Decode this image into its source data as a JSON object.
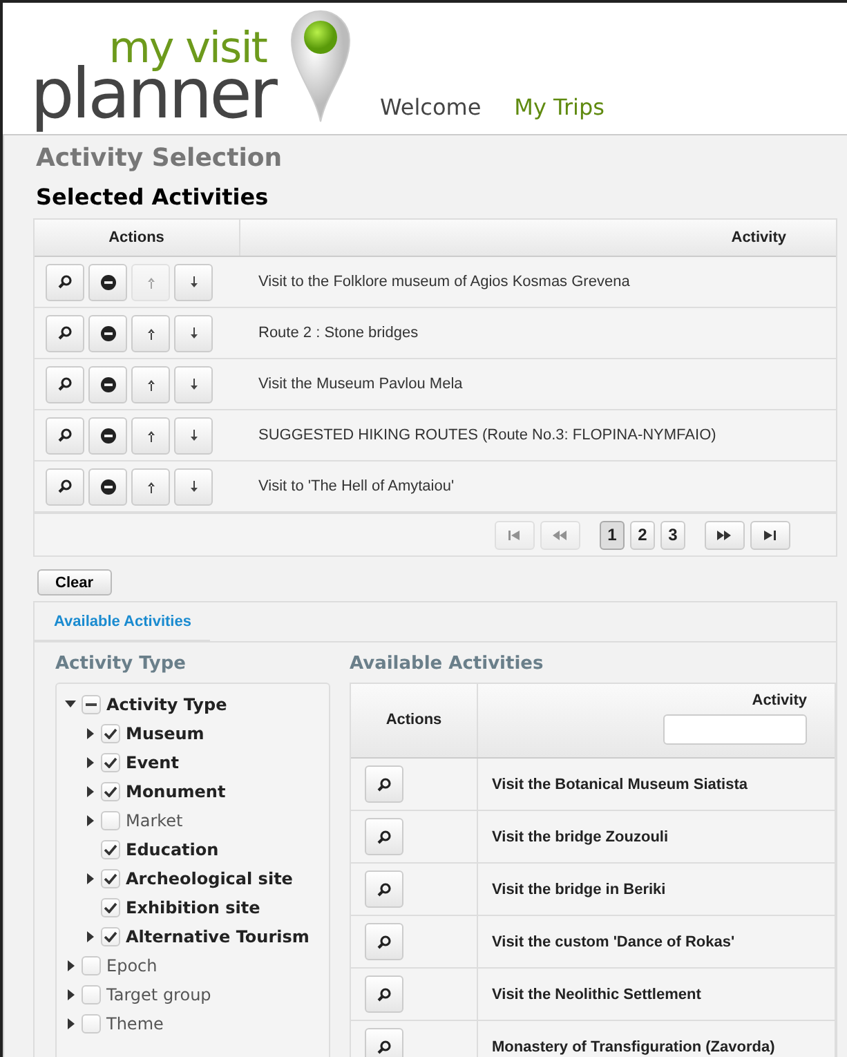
{
  "logo": {
    "top": "my visit",
    "bottom": "planner"
  },
  "nav": [
    {
      "label": "Welcome",
      "selected": false
    },
    {
      "label": "My Trips",
      "selected": true
    }
  ],
  "page_title": "Activity Selection",
  "selected_activities": {
    "title": "Selected Activities",
    "columns": [
      "Actions",
      "Activity"
    ],
    "rows": [
      {
        "activity": "Visit to the Folklore museum of Agios Kosmas Grevena",
        "actions": [
          {
            "kind": "view",
            "disabled": false
          },
          {
            "kind": "remove",
            "disabled": false
          },
          {
            "kind": "up",
            "disabled": true
          },
          {
            "kind": "down",
            "disabled": false
          }
        ]
      },
      {
        "activity": "Route 2 : Stone bridges",
        "actions": [
          {
            "kind": "view",
            "disabled": false
          },
          {
            "kind": "remove",
            "disabled": false
          },
          {
            "kind": "up",
            "disabled": false
          },
          {
            "kind": "down",
            "disabled": false
          }
        ]
      },
      {
        "activity": "Visit the Museum Pavlou Mela",
        "actions": [
          {
            "kind": "view",
            "disabled": false
          },
          {
            "kind": "remove",
            "disabled": false
          },
          {
            "kind": "up",
            "disabled": false
          },
          {
            "kind": "down",
            "disabled": false
          }
        ]
      },
      {
        "activity": "SUGGESTED HIKING ROUTES (Route No.3: FLOPINA-NYMFAIO)",
        "actions": [
          {
            "kind": "view",
            "disabled": false
          },
          {
            "kind": "remove",
            "disabled": false
          },
          {
            "kind": "up",
            "disabled": false
          },
          {
            "kind": "down",
            "disabled": false
          }
        ]
      },
      {
        "activity": "Visit to 'The Hell of Amytaiou'",
        "actions": [
          {
            "kind": "view",
            "disabled": false
          },
          {
            "kind": "remove",
            "disabled": false
          },
          {
            "kind": "up",
            "disabled": false
          },
          {
            "kind": "down",
            "disabled": false
          }
        ]
      }
    ],
    "paginator": {
      "nav": [
        {
          "kind": "first",
          "disabled": true
        },
        {
          "kind": "prev",
          "disabled": true
        },
        {
          "kind": "next",
          "disabled": false
        },
        {
          "kind": "last",
          "disabled": false
        }
      ],
      "pages": [
        {
          "label": "1",
          "selected": true
        },
        {
          "label": "2",
          "selected": false
        },
        {
          "label": "3",
          "selected": false
        }
      ]
    }
  },
  "clear_button": "Clear",
  "available_panel": {
    "header": "Available Activities",
    "type_title": "Activity Type",
    "tree": [
      {
        "label": "Activity Type",
        "indeterminate": true,
        "expanded": true,
        "children": [
          {
            "label": "Museum",
            "checked": true,
            "expanded": false
          },
          {
            "label": "Event",
            "checked": true,
            "expanded": false
          },
          {
            "label": "Monument",
            "checked": true,
            "expanded": false
          },
          {
            "label": "Market",
            "checked": false,
            "expanded": false
          },
          {
            "label": "Education",
            "checked": true
          },
          {
            "label": "Archeological site",
            "checked": true,
            "expanded": false
          },
          {
            "label": "Exhibition site",
            "checked": true
          },
          {
            "label": "Alternative Tourism",
            "checked": true,
            "expanded": false
          }
        ]
      },
      {
        "label": "Epoch",
        "checked": false,
        "expanded": false
      },
      {
        "label": "Target group",
        "checked": false,
        "expanded": false
      },
      {
        "label": "Theme",
        "checked": false,
        "expanded": false
      }
    ],
    "list_title": "Available Activities",
    "columns": [
      "Actions",
      "Activity"
    ],
    "rows": [
      "Visit the Botanical Museum Siatista",
      "Visit the bridge Zouzouli",
      "Visit the bridge in Beriki",
      "Visit the custom 'Dance of Rokas'",
      "Visit the Neolithic Settlement",
      "Monastery of Transfiguration (Zavorda)"
    ]
  }
}
